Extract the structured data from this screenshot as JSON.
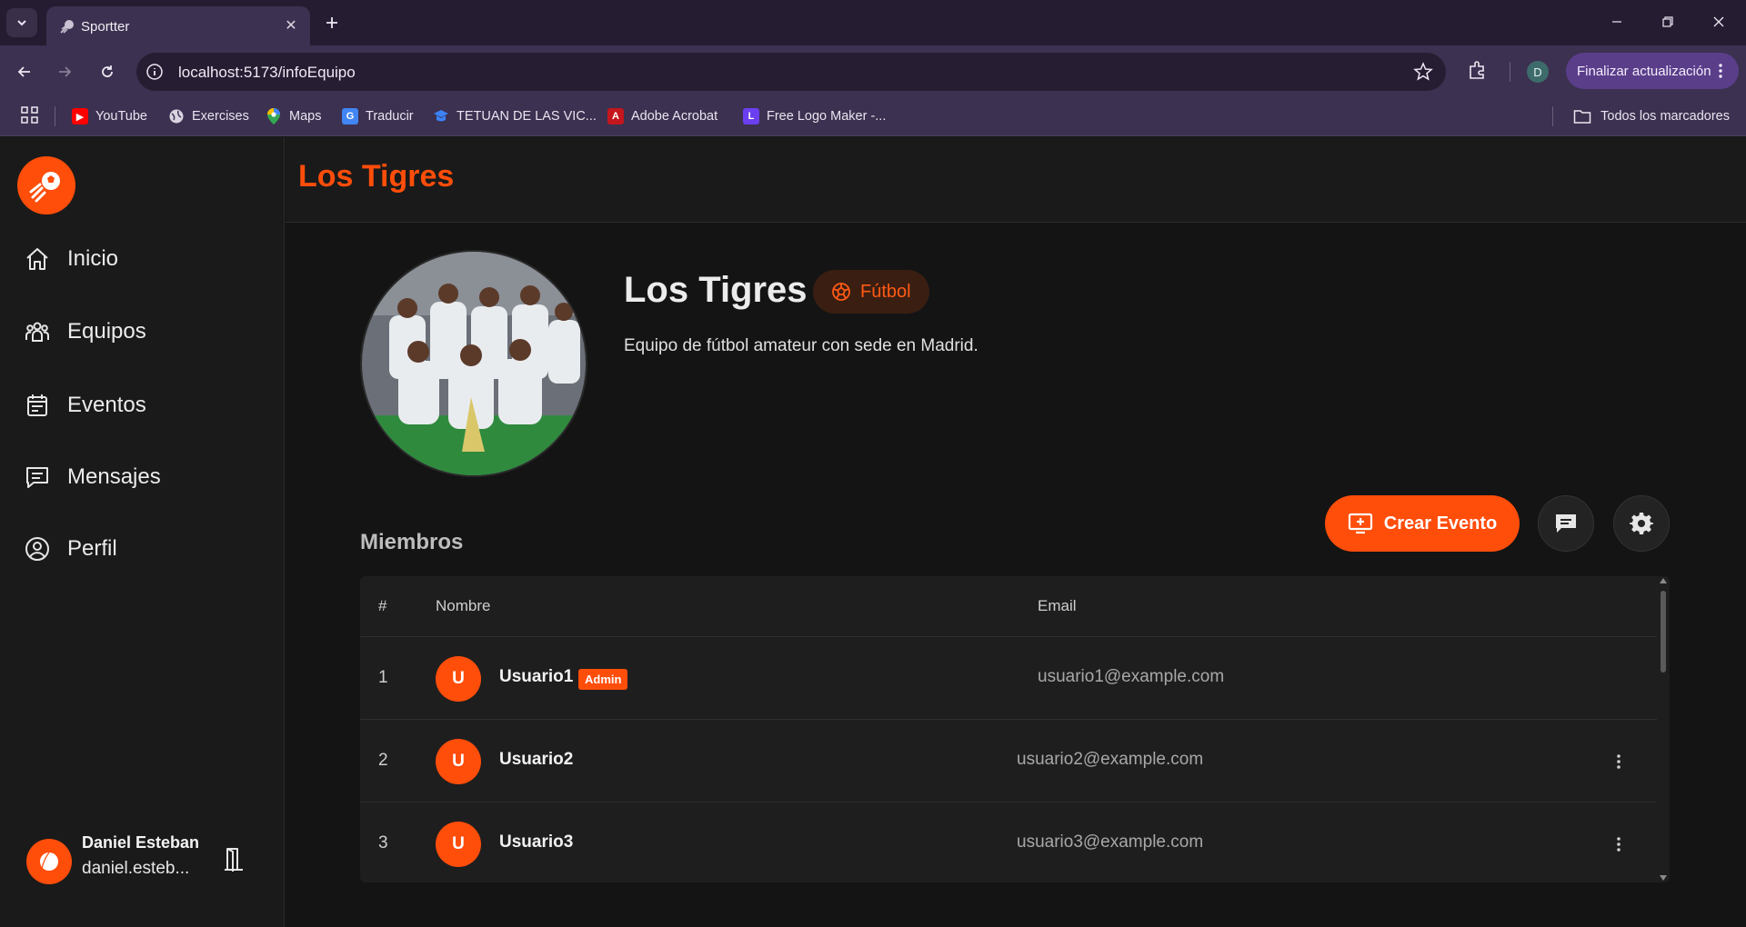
{
  "browser": {
    "tab_title": "Sportter",
    "url": "localhost:5173/infoEquipo",
    "profile_initial": "D",
    "update_label": "Finalizar actualización",
    "bookmarks": [
      {
        "label": "YouTube",
        "icon": "youtube-icon"
      },
      {
        "label": "Exercises",
        "icon": "globe-icon"
      },
      {
        "label": "Maps",
        "icon": "maps-icon"
      },
      {
        "label": "Traducir",
        "icon": "translate-icon"
      },
      {
        "label": "TETUAN DE LAS VIC...",
        "icon": "school-icon"
      },
      {
        "label": "Adobe Acrobat",
        "icon": "acrobat-icon"
      },
      {
        "label": "Free Logo Maker -...",
        "icon": "logo-maker-icon"
      }
    ],
    "all_bookmarks_label": "Todos los marcadores"
  },
  "sidebar": {
    "items": [
      {
        "label": "Inicio",
        "icon": "home-icon"
      },
      {
        "label": "Equipos",
        "icon": "team-icon"
      },
      {
        "label": "Eventos",
        "icon": "calendar-icon"
      },
      {
        "label": "Mensajes",
        "icon": "message-icon"
      },
      {
        "label": "Perfil",
        "icon": "user-circle-icon"
      }
    ],
    "user": {
      "name": "Daniel Esteban",
      "email": "daniel.esteb..."
    }
  },
  "header": {
    "title": "Los Tigres"
  },
  "team": {
    "name": "Los Tigres",
    "sport": "Fútbol",
    "description": "Equipo de fútbol amateur con sede en Madrid."
  },
  "actions": {
    "create_event_label": "Crear Evento"
  },
  "members": {
    "title": "Miembros",
    "columns": [
      "#",
      "Nombre",
      "Email"
    ],
    "rows": [
      {
        "num": "1",
        "initial": "U",
        "name": "Usuario1",
        "badge": "Admin",
        "email": "usuario1@example.com"
      },
      {
        "num": "2",
        "initial": "U",
        "name": "Usuario2",
        "email": "usuario2@example.com"
      },
      {
        "num": "3",
        "initial": "U",
        "name": "Usuario3",
        "email": "usuario3@example.com"
      }
    ]
  },
  "colors": {
    "accent": "#ff4d0a",
    "background": "#141414",
    "panel": "#1a1a1a",
    "chrome": "#3c3150"
  }
}
